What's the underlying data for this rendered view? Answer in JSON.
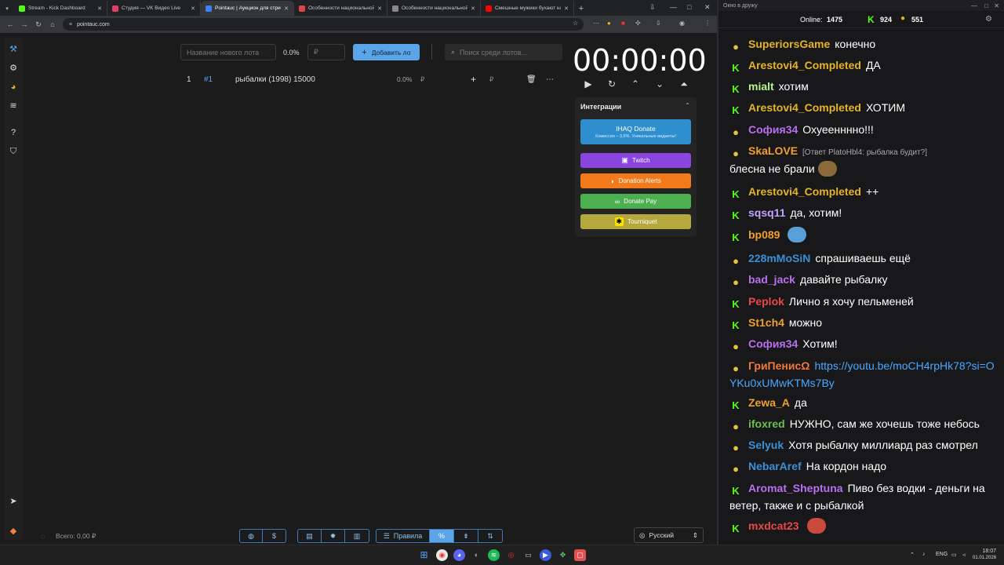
{
  "browser": {
    "tabs": [
      {
        "title": "Stream - Kick Dashboard",
        "color": "#53fc18"
      },
      {
        "title": "Студия — VK Видео Live",
        "color": "#e33b6a"
      },
      {
        "title": "Pointauc | Аукцион для стримеров",
        "color": "#3b82f6",
        "active": true
      },
      {
        "title": "Особенности национальной рыбалки",
        "color": "#d44"
      },
      {
        "title": "Особенности национальной рыбалки",
        "color": "#888"
      },
      {
        "title": "Смешные мужики бухают на рыбалке",
        "color": "#f00"
      }
    ],
    "url": "pointauc.com",
    "new_tab": "+",
    "tab_close": "✕"
  },
  "app": {
    "new_lot_placeholder": "Название нового лота",
    "percent": "0.0%",
    "amount_placeholder": "₽",
    "add_button": "Добавить лот",
    "search_placeholder": "Поиск среди лотов...",
    "lot": {
      "index": "1",
      "id": "#1",
      "name": "рыбалки (1998) 15000",
      "percent": "0.0%",
      "currency": "₽"
    },
    "timer": "00:00:00",
    "integrations": {
      "title": "Интеграции",
      "ihaq": {
        "label": "IHAQ Donate",
        "sub": "Комиссия – 3,5%. Уникальные виджеты!"
      },
      "twitch": "Twitch",
      "donation_alerts": "Donation Alerts",
      "donate_pay": "Donate Pay",
      "tourniquet": "Tourniquet"
    },
    "total": "Всего: 0,00 ₽",
    "rules": "Правила",
    "language": "Русский"
  },
  "chat": {
    "window_title": "Окно в дружу",
    "online_label": "Online:",
    "online": "1475",
    "kick_count": "924",
    "other_count": "551",
    "messages": [
      {
        "badge": "s",
        "name": "SuperiorsGame",
        "color": "#e6b422",
        "text": "конечно"
      },
      {
        "badge": "k",
        "name": "Arestovi4_Completed",
        "color": "#e6b422",
        "text": "ДА"
      },
      {
        "badge": "k",
        "name": "mialt",
        "color": "#b8f58a",
        "text": "хотим"
      },
      {
        "badge": "k",
        "name": "Arestovi4_Completed",
        "color": "#e6b422",
        "text": "ХОТИМ"
      },
      {
        "badge": "s",
        "name": "София34",
        "color": "#b96ff0",
        "text": "Охуеенннно!!!"
      },
      {
        "badge": "s",
        "name": "SkaLOVE",
        "color": "#f0a030",
        "reply": "[Ответ PlatoHbl4: рыбалка будит?]",
        "text": "блесна не брали"
      },
      {
        "badge": "k",
        "name": "Arestovi4_Completed",
        "color": "#e6b422",
        "text": "++"
      },
      {
        "badge": "k",
        "name": "sqsq11",
        "color": "#c5a0ff",
        "text": "да, хотим!"
      },
      {
        "badge": "k",
        "name": "bp089",
        "color": "#f0a030",
        "text": ""
      },
      {
        "badge": "s",
        "name": "228mMoSiN",
        "color": "#3a8fd6",
        "text": "спрашиваешь ещё"
      },
      {
        "badge": "s",
        "name": "bad_jack",
        "color": "#b96ff0",
        "text": "давайте рыбалку"
      },
      {
        "badge": "k",
        "name": "Peplok",
        "color": "#e84848",
        "text": "Лично я хочу пельменей"
      },
      {
        "badge": "k",
        "name": "St1ch4",
        "color": "#f0a030",
        "text": "можно"
      },
      {
        "badge": "s",
        "name": "София34",
        "color": "#b96ff0",
        "text": "Хотим!"
      },
      {
        "badge": "s",
        "name": "ГриПенисΩ",
        "color": "#f07a3a",
        "link": "https://youtu.be/moCH4rpHk78?si=OYKu0xUMwKTMs7By",
        "text": ""
      },
      {
        "badge": "k",
        "name": "Zewa_A",
        "color": "#f0a030",
        "text": "да"
      },
      {
        "badge": "s",
        "name": "ifoxred",
        "color": "#6cc04a",
        "text": "НУЖНО, сам же хочешь тоже небось"
      },
      {
        "badge": "s",
        "name": "Selyuk",
        "color": "#3a8fd6",
        "text": "Хотя рыбалку миллиард раз смотрел"
      },
      {
        "badge": "s",
        "name": "NebarAref",
        "color": "#3a8fd6",
        "text": "На кордон надо"
      },
      {
        "badge": "k",
        "name": "Aromat_Sheptuna",
        "color": "#b96ff0",
        "text": "Пиво без водки - деньги на ветер, также и с рыбалкой"
      },
      {
        "badge": "k",
        "name": "mxdcat23",
        "color": "#e84848",
        "text": ""
      }
    ]
  },
  "taskbar": {
    "lang": "ENG",
    "time": "18:07",
    "date": "01.01.2026"
  }
}
